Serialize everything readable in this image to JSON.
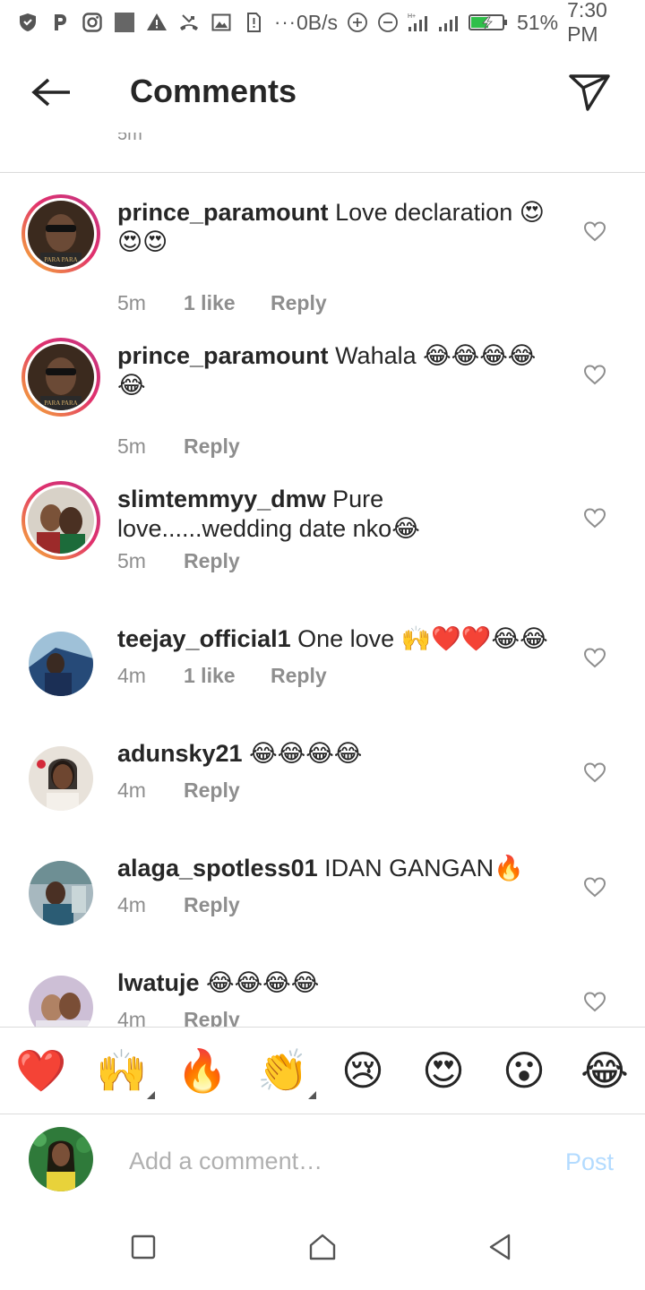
{
  "status_bar": {
    "net_speed": "0B/s",
    "battery": "51%",
    "time": "7:30 PM",
    "dots": "···",
    "left_icons": [
      "shield-icon",
      "p-app-icon",
      "instagram-icon",
      "gallery-square-icon",
      "warning-icon",
      "missed-call-icon",
      "image-icon",
      "sim-alert-icon"
    ],
    "right_icons": [
      "data-saver-plus-icon",
      "dnd-minus-icon",
      "signal-icon",
      "signal-icon",
      "battery-charging-icon"
    ]
  },
  "header": {
    "title": "Comments",
    "back_icon": "arrow-left-icon",
    "share_icon": "paper-plane-icon"
  },
  "peek_text": "5m",
  "comments": [
    {
      "user": "prince_paramount",
      "text": "Love declaration 😍😍😍",
      "time": "5m",
      "likes": "1 like",
      "reply": "Reply"
    },
    {
      "user": "prince_paramount",
      "text": "Wahala 😂😂😂😂😂",
      "time": "5m",
      "likes": "",
      "reply": "Reply"
    },
    {
      "user": "slimtemmyy_dmw",
      "text": "Pure love......wedding date nko😂",
      "time": "5m",
      "likes": "",
      "reply": "Reply"
    },
    {
      "user": "teejay_official1",
      "text": "One love 🙌❤️❤️😂😂",
      "time": "4m",
      "likes": "1 like",
      "reply": "Reply"
    },
    {
      "user": "adunsky21",
      "text": "😂😂😂😂",
      "time": "4m",
      "likes": "",
      "reply": "Reply"
    },
    {
      "user": "alaga_spotless01",
      "text": "IDAN GANGAN🔥",
      "time": "4m",
      "likes": "",
      "reply": "Reply"
    },
    {
      "user": "lwatuje",
      "text": "😂😂😂😂",
      "time": "4m",
      "likes": "",
      "reply": "Reply"
    }
  ],
  "quick_reactions": [
    "❤️",
    "🙌",
    "🔥",
    "👏",
    "😢",
    "😍",
    "😮",
    "😂"
  ],
  "composer": {
    "placeholder": "Add a comment…",
    "post_label": "Post"
  },
  "colors": {
    "text": "#262626",
    "muted": "#8e8e8e",
    "post_disabled": "#b3dbff",
    "divider": "#dbdbdb",
    "story_ring_start": "#f7b733",
    "story_ring_end": "#c13584"
  }
}
